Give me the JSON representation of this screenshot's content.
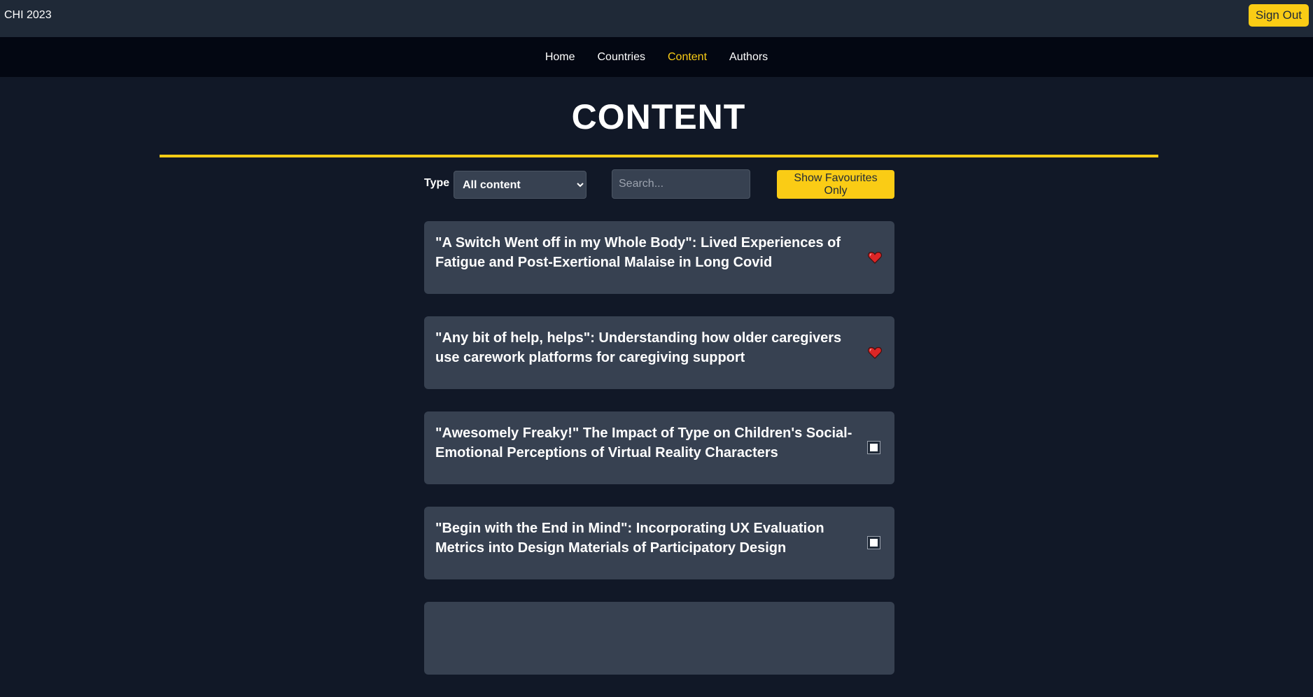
{
  "app": {
    "title": "CHI 2023",
    "sign_out_label": "Sign Out"
  },
  "nav": {
    "items": [
      {
        "label": "Home",
        "active": false
      },
      {
        "label": "Countries",
        "active": false
      },
      {
        "label": "Content",
        "active": true
      },
      {
        "label": "Authors",
        "active": false
      }
    ]
  },
  "page": {
    "title": "CONTENT"
  },
  "filters": {
    "type_label": "Type",
    "type_selected": "All content",
    "search_placeholder": "Search...",
    "search_value": "",
    "favourites_button_label": "Show Favourites Only"
  },
  "content_items": [
    {
      "title": "\"A Switch Went off in my Whole Body\": Lived Experiences of Fatigue and Post-Exertional Malaise in Long Covid",
      "favourite": true
    },
    {
      "title": "\"Any bit of help, helps\": Understanding how older caregivers use carework platforms for caregiving support",
      "favourite": true
    },
    {
      "title": "\"Awesomely Freaky!\" The Impact of Type on Children's Social-Emotional Perceptions of Virtual Reality Characters",
      "favourite": false
    },
    {
      "title": "\"Begin with the End in Mind\": Incorporating UX Evaluation Metrics into Design Materials of Participatory Design",
      "favourite": false
    },
    {
      "title": "",
      "favourite": false
    }
  ],
  "colors": {
    "accent": "#facc15",
    "background": "#111827",
    "topbar": "#1f2937",
    "navbar": "#030712",
    "card": "#374151",
    "heart": "#dc2626"
  },
  "icons": {
    "favourite_on": "heart-icon",
    "favourite_off": "checkbox-icon"
  }
}
